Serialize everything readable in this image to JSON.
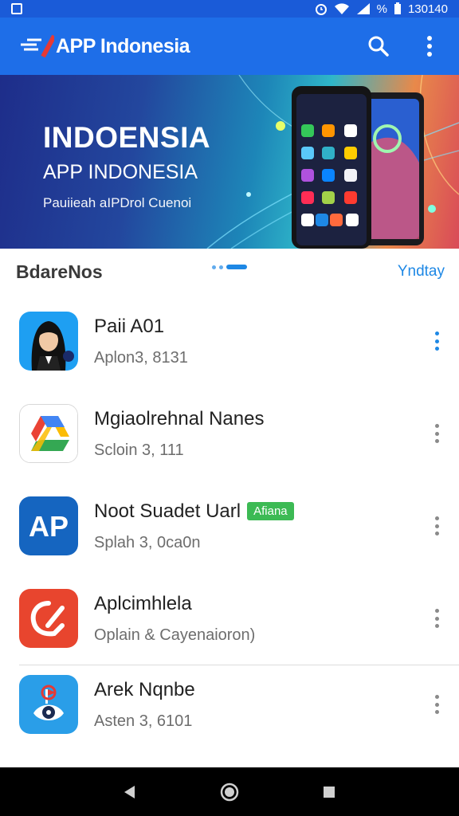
{
  "status_bar": {
    "battery_text": "%",
    "time": "130140"
  },
  "app_bar": {
    "title": "APP Indonesia",
    "icons": [
      "search-icon",
      "more-vertical-icon"
    ]
  },
  "banner": {
    "title": "INDOENSIA",
    "subtitle": "APP INDONESIA",
    "tagline": "Pauiieah aIPDrol Cuenoi"
  },
  "section": {
    "title": "BdareNos",
    "link": "Yndtay"
  },
  "apps": [
    {
      "name": "Paii A01",
      "meta": "Aplon3, 8131",
      "badge": "",
      "icon": "avatar-app-icon"
    },
    {
      "name": "Mgiaolrehnal Nanes",
      "meta": "Scloin 3, 111",
      "badge": "",
      "icon": "drive-app-icon"
    },
    {
      "name": "Noot Suadet Uarl",
      "meta": "Splah 3, 0ca0n",
      "badge": "Afiana",
      "icon": "ap-app-icon"
    },
    {
      "name": "Aplcimhlela",
      "meta": "Oplain & Cayenaioron)",
      "badge": "",
      "icon": "red-app-icon"
    },
    {
      "name": "Arek Nqnbe",
      "meta": "Asten 3, 6101",
      "badge": "",
      "icon": "eye-app-icon"
    }
  ],
  "colors": {
    "primary": "#1e6ee8",
    "status": "#1a5bd8",
    "link": "#1e88e5",
    "badge": "#3cba54"
  },
  "nav_bar": {
    "icons": [
      "back-icon",
      "home-icon",
      "recents-icon"
    ]
  }
}
